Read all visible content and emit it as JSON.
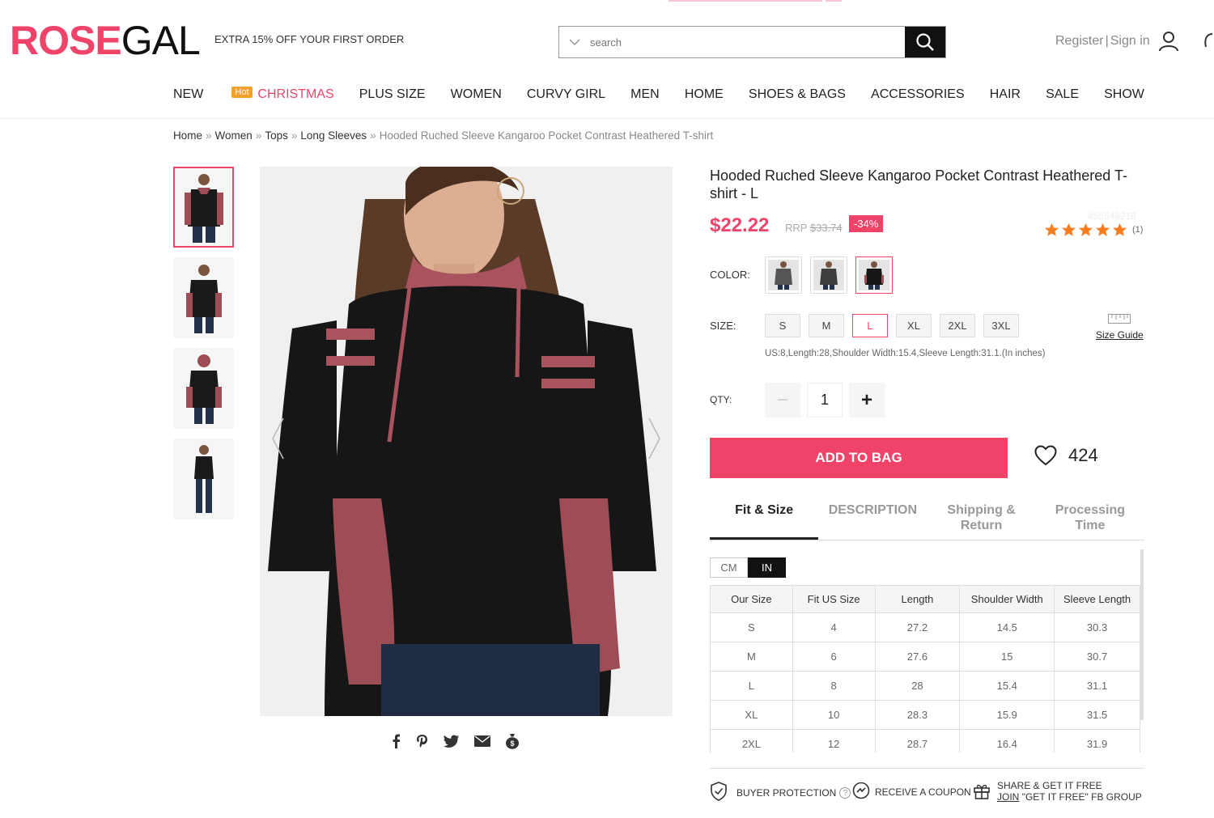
{
  "brand": {
    "part1": "ROSE",
    "part2": "GAL",
    "accent": "#f0436a"
  },
  "header": {
    "promo": "EXTRA 15% OFF YOUR FIRST ORDER",
    "search_placeholder": "search",
    "register": "Register",
    "separator": "|",
    "signin": "Sign in"
  },
  "nav": {
    "hot_badge": "Hot",
    "items": [
      "NEW",
      "CHRISTMAS",
      "PLUS SIZE",
      "WOMEN",
      "CURVY GIRL",
      "MEN",
      "HOME",
      "SHOES & BAGS",
      "ACCESSORIES",
      "HAIR",
      "SALE",
      "SHOW"
    ]
  },
  "breadcrumb": {
    "sep": "»",
    "items": [
      "Home",
      "Women",
      "Tops",
      "Long Sleeves"
    ],
    "current": "Hooded Ruched Sleeve Kangaroo Pocket Contrast Heathered T-shirt"
  },
  "product": {
    "title": "Hooded Ruched Sleeve Kangaroo Pocket Contrast Heathered T-shirt - L",
    "price": "$22.22",
    "rrp_label": "RRP",
    "rrp_value": "$33.74",
    "discount": "-34%",
    "sku": "455548216",
    "rating": 5,
    "review_count": "(1)",
    "color_label": "COLOR:",
    "size_label": "SIZE:",
    "sizes": [
      "S",
      "M",
      "L",
      "XL",
      "2XL",
      "3XL"
    ],
    "selected_size": "L",
    "size_guide": "Size Guide",
    "measure": "US:8,Length:28,Shoulder Width:15.4,Sleeve Length:31.1.(In inches)",
    "qty_label": "QTY:",
    "qty": "1",
    "minus": "−",
    "plus": "+",
    "add_to_bag": "ADD TO BAG",
    "wishlist_count": "424"
  },
  "tabs": [
    {
      "line1": "Fit & Size",
      "line2": ""
    },
    {
      "line1": "DESCRIPTION",
      "line2": ""
    },
    {
      "line1": "Shipping &",
      "line2": "Return"
    },
    {
      "line1": "Processing",
      "line2": "Time"
    }
  ],
  "units": {
    "cm": "CM",
    "in": "IN"
  },
  "size_table": {
    "headers": [
      "Our Size",
      "Fit US Size",
      "Length",
      "Shoulder Width",
      "Sleeve Length"
    ],
    "rows": [
      [
        "S",
        "4",
        "27.2",
        "14.5",
        "30.3"
      ],
      [
        "M",
        "6",
        "27.6",
        "15",
        "30.7"
      ],
      [
        "L",
        "8",
        "28",
        "15.4",
        "31.1"
      ],
      [
        "XL",
        "10",
        "28.3",
        "15.9",
        "31.5"
      ],
      [
        "2XL",
        "12",
        "28.7",
        "16.4",
        "31.9"
      ]
    ]
  },
  "trust": {
    "buyer": "BUYER PROTECTION",
    "coupon": "RECEIVE A COUPON",
    "share_line1": "SHARE & GET IT FREE",
    "join": "JOIN",
    "share_line2": "\"GET IT FREE\" FB GROUP"
  },
  "icons": [
    "search-icon",
    "user-icon",
    "heart-icon",
    "facebook-icon",
    "pinterest-icon",
    "twitter-icon",
    "email-icon",
    "money-bag-icon",
    "shield-icon",
    "coupon-icon",
    "gift-icon",
    "ruler-icon"
  ]
}
